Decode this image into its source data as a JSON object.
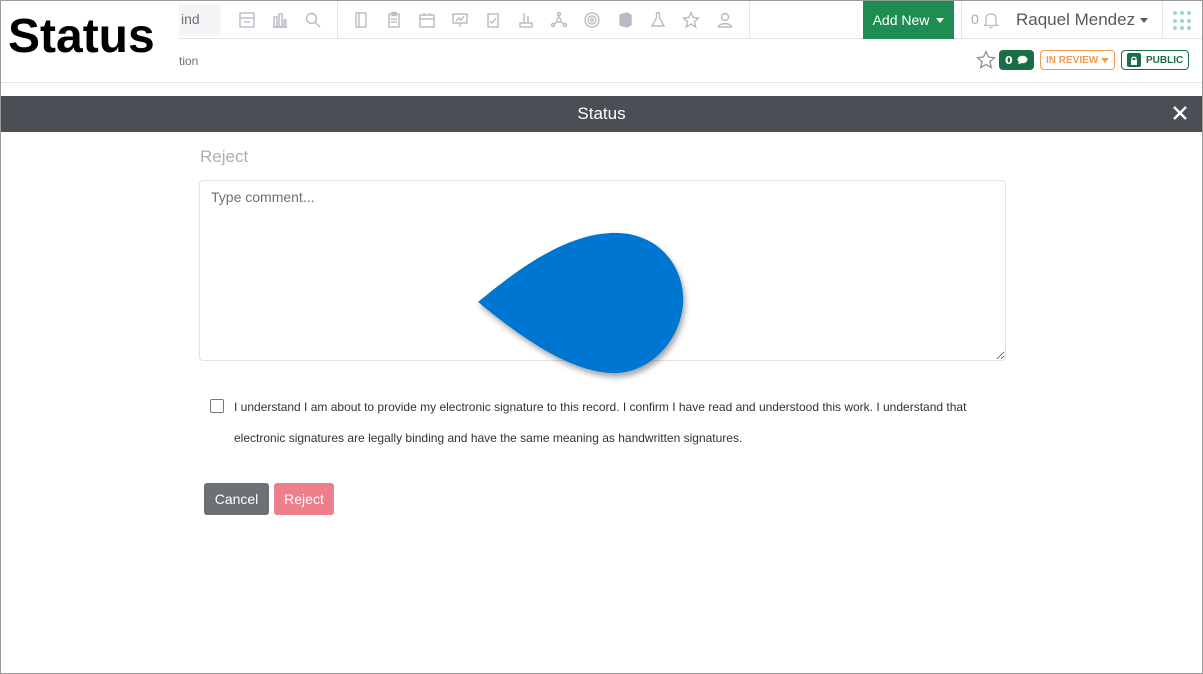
{
  "overlay": {
    "title": "Status"
  },
  "topnav": {
    "find_text": "ind",
    "add_new_label": "Add New",
    "notification_count": "0",
    "user_name": "Raquel Mendez",
    "accent_color": "#1f8c54"
  },
  "subheader": {
    "breadcrumb_text": "tion",
    "comment_count": "0",
    "review_status": "IN REVIEW",
    "visibility": "PUBLIC"
  },
  "modal": {
    "title": "Status",
    "section_label": "Reject",
    "comment_placeholder": "Type comment...",
    "signature_text_line1": "I understand I am about to provide my electronic signature to this record. I confirm I have read and understood this work. I understand that",
    "signature_text_line2": "electronic signatures are legally binding and have the same meaning as handwritten signatures.",
    "cancel_label": "Cancel",
    "reject_label": "Reject"
  }
}
